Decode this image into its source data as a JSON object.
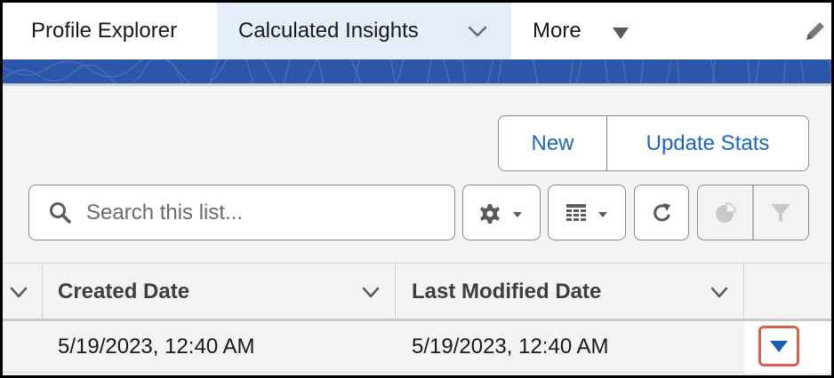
{
  "nav": {
    "tabs": [
      {
        "label": "Profile Explorer"
      },
      {
        "label": "Calculated Insights",
        "active": true,
        "icon": "chevron-down-icon"
      },
      {
        "label": "More",
        "icon": "triangle-down-icon"
      }
    ],
    "edit_icon": "pencil-icon"
  },
  "colors": {
    "accent": "#1a66c2",
    "banner": "#2c56a8",
    "active_tab": "#e5eef8",
    "highlight": "#d9604a"
  },
  "actions": {
    "new_label": "New",
    "update_stats_label": "Update Stats"
  },
  "search": {
    "placeholder": "Search this list...",
    "icon": "search-icon"
  },
  "toolbar_icons": [
    "gear-icon",
    "table-icon",
    "refresh-icon",
    "pie-chart-icon",
    "filter-icon"
  ],
  "table": {
    "columns": [
      {
        "label": ""
      },
      {
        "label": "Created Date"
      },
      {
        "label": "Last Modified Date"
      }
    ],
    "rows": [
      {
        "created": "5/19/2023, 12:40 AM",
        "modified": "5/19/2023, 12:40 AM"
      }
    ]
  }
}
